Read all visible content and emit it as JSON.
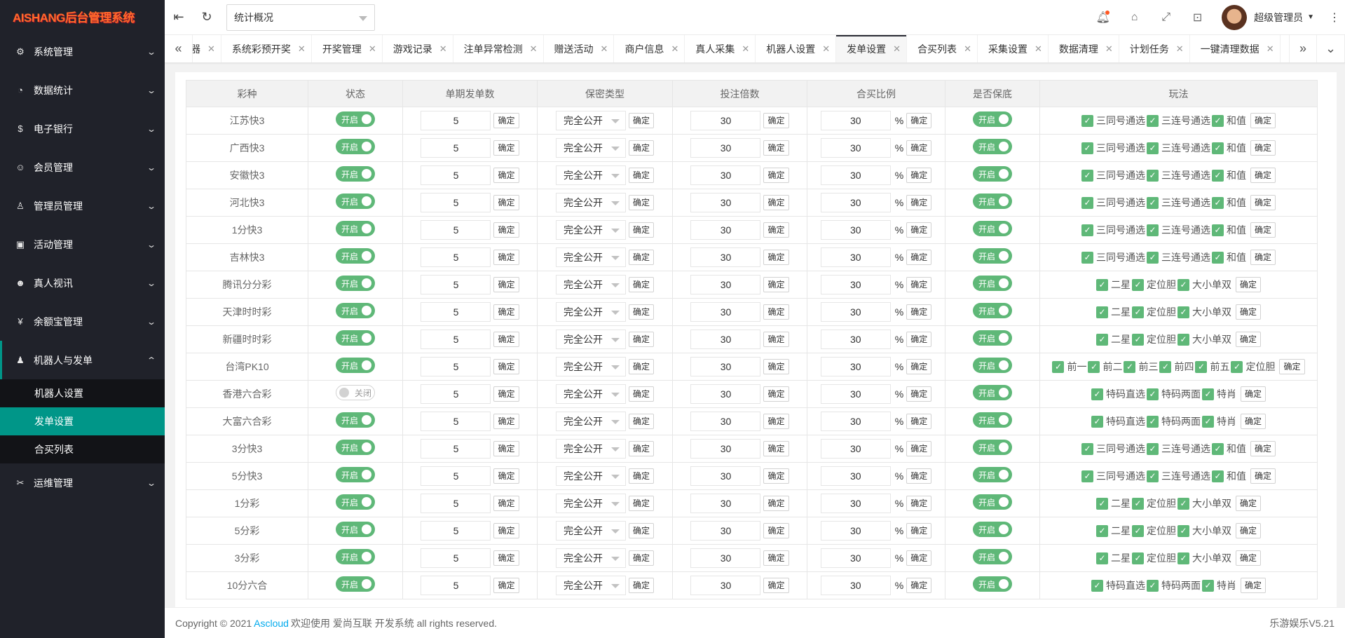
{
  "app": {
    "logo": "AISHANG后台管理系统"
  },
  "sidebar": {
    "items": [
      {
        "label": "系统管理",
        "icon": "gear-icon",
        "glyph": "⚙"
      },
      {
        "label": "数据统计",
        "icon": "dashboard-icon",
        "glyph": "◔"
      },
      {
        "label": "电子银行",
        "icon": "dollar-icon",
        "glyph": "$"
      },
      {
        "label": "会员管理",
        "icon": "users-icon",
        "glyph": "☺"
      },
      {
        "label": "管理员管理",
        "icon": "user-icon",
        "glyph": "♙"
      },
      {
        "label": "活动管理",
        "icon": "gift-icon",
        "glyph": "▣"
      },
      {
        "label": "真人视讯",
        "icon": "group-icon",
        "glyph": "☻"
      },
      {
        "label": "余额宝管理",
        "icon": "yen-icon",
        "glyph": "¥"
      },
      {
        "label": "机器人与发单",
        "icon": "user-solid-icon",
        "glyph": "♟"
      },
      {
        "label": "运维管理",
        "icon": "tools-icon",
        "glyph": "✂"
      }
    ],
    "submenu": [
      {
        "label": "机器人设置"
      },
      {
        "label": "发单设置"
      },
      {
        "label": "合买列表"
      }
    ]
  },
  "header": {
    "select_value": "统计概况",
    "user_name": "超级管理员"
  },
  "tabs": [
    {
      "label": "器"
    },
    {
      "label": "系统彩预开奖"
    },
    {
      "label": "开奖管理"
    },
    {
      "label": "游戏记录"
    },
    {
      "label": "注单异常检测"
    },
    {
      "label": "赠送活动"
    },
    {
      "label": "商户信息"
    },
    {
      "label": "真人采集"
    },
    {
      "label": "机器人设置"
    },
    {
      "label": "发单设置"
    },
    {
      "label": "合买列表"
    },
    {
      "label": "采集设置"
    },
    {
      "label": "数据清理"
    },
    {
      "label": "计划任务"
    },
    {
      "label": "一键清理数据"
    }
  ],
  "table": {
    "headers": [
      "彩种",
      "状态",
      "单期发单数",
      "保密类型",
      "投注倍数",
      "合买比例",
      "是否保底",
      "玩法"
    ],
    "on_label": "开启",
    "off_label": "关闭",
    "confirm_label": "确定",
    "percent": "%",
    "rows": [
      {
        "name": "江苏快3",
        "status": "开启",
        "count": "5",
        "secrecy": "完全公开",
        "multiple": "30",
        "ratio": "30",
        "guarantee": "开启",
        "plays": [
          "三同号通选",
          "三连号通选",
          "和值"
        ]
      },
      {
        "name": "广西快3",
        "status": "开启",
        "count": "5",
        "secrecy": "完全公开",
        "multiple": "30",
        "ratio": "30",
        "guarantee": "开启",
        "plays": [
          "三同号通选",
          "三连号通选",
          "和值"
        ]
      },
      {
        "name": "安徽快3",
        "status": "开启",
        "count": "5",
        "secrecy": "完全公开",
        "multiple": "30",
        "ratio": "30",
        "guarantee": "开启",
        "plays": [
          "三同号通选",
          "三连号通选",
          "和值"
        ]
      },
      {
        "name": "河北快3",
        "status": "开启",
        "count": "5",
        "secrecy": "完全公开",
        "multiple": "30",
        "ratio": "30",
        "guarantee": "开启",
        "plays": [
          "三同号通选",
          "三连号通选",
          "和值"
        ]
      },
      {
        "name": "1分快3",
        "status": "开启",
        "count": "5",
        "secrecy": "完全公开",
        "multiple": "30",
        "ratio": "30",
        "guarantee": "开启",
        "plays": [
          "三同号通选",
          "三连号通选",
          "和值"
        ]
      },
      {
        "name": "吉林快3",
        "status": "开启",
        "count": "5",
        "secrecy": "完全公开",
        "multiple": "30",
        "ratio": "30",
        "guarantee": "开启",
        "plays": [
          "三同号通选",
          "三连号通选",
          "和值"
        ]
      },
      {
        "name": "腾讯分分彩",
        "status": "开启",
        "count": "5",
        "secrecy": "完全公开",
        "multiple": "30",
        "ratio": "30",
        "guarantee": "开启",
        "plays": [
          "二星",
          "定位胆",
          "大小单双"
        ]
      },
      {
        "name": "天津时时彩",
        "status": "开启",
        "count": "5",
        "secrecy": "完全公开",
        "multiple": "30",
        "ratio": "30",
        "guarantee": "开启",
        "plays": [
          "二星",
          "定位胆",
          "大小单双"
        ]
      },
      {
        "name": "新疆时时彩",
        "status": "开启",
        "count": "5",
        "secrecy": "完全公开",
        "multiple": "30",
        "ratio": "30",
        "guarantee": "开启",
        "plays": [
          "二星",
          "定位胆",
          "大小单双"
        ]
      },
      {
        "name": "台湾PK10",
        "status": "开启",
        "count": "5",
        "secrecy": "完全公开",
        "multiple": "30",
        "ratio": "30",
        "guarantee": "开启",
        "plays": [
          "前一",
          "前二",
          "前三",
          "前四",
          "前五",
          "定位胆"
        ]
      },
      {
        "name": "香港六合彩",
        "status": "关闭",
        "count": "5",
        "secrecy": "完全公开",
        "multiple": "30",
        "ratio": "30",
        "guarantee": "开启",
        "plays": [
          "特码直选",
          "特码两面",
          "特肖"
        ]
      },
      {
        "name": "大富六合彩",
        "status": "开启",
        "count": "5",
        "secrecy": "完全公开",
        "multiple": "30",
        "ratio": "30",
        "guarantee": "开启",
        "plays": [
          "特码直选",
          "特码两面",
          "特肖"
        ]
      },
      {
        "name": "3分快3",
        "status": "开启",
        "count": "5",
        "secrecy": "完全公开",
        "multiple": "30",
        "ratio": "30",
        "guarantee": "开启",
        "plays": [
          "三同号通选",
          "三连号通选",
          "和值"
        ]
      },
      {
        "name": "5分快3",
        "status": "开启",
        "count": "5",
        "secrecy": "完全公开",
        "multiple": "30",
        "ratio": "30",
        "guarantee": "开启",
        "plays": [
          "三同号通选",
          "三连号通选",
          "和值"
        ]
      },
      {
        "name": "1分彩",
        "status": "开启",
        "count": "5",
        "secrecy": "完全公开",
        "multiple": "30",
        "ratio": "30",
        "guarantee": "开启",
        "plays": [
          "二星",
          "定位胆",
          "大小单双"
        ]
      },
      {
        "name": "5分彩",
        "status": "开启",
        "count": "5",
        "secrecy": "完全公开",
        "multiple": "30",
        "ratio": "30",
        "guarantee": "开启",
        "plays": [
          "二星",
          "定位胆",
          "大小单双"
        ]
      },
      {
        "name": "3分彩",
        "status": "开启",
        "count": "5",
        "secrecy": "完全公开",
        "multiple": "30",
        "ratio": "30",
        "guarantee": "开启",
        "plays": [
          "二星",
          "定位胆",
          "大小单双"
        ]
      },
      {
        "name": "10分六合",
        "status": "开启",
        "count": "5",
        "secrecy": "完全公开",
        "multiple": "30",
        "ratio": "30",
        "guarantee": "开启",
        "plays": [
          "特码直选",
          "特码两面",
          "特肖"
        ]
      }
    ]
  },
  "footer": {
    "copyright": "Copyright © 2021",
    "link": "Ascloud",
    "text": "欢迎使用 爱尚互联 开发系统 all rights reserved.",
    "version": "乐游娱乐V5.21"
  },
  "colors": {
    "accent": "#009688",
    "switch_on": "#5fb878",
    "sidebar_bg": "#20222a",
    "link": "#01aaed"
  }
}
